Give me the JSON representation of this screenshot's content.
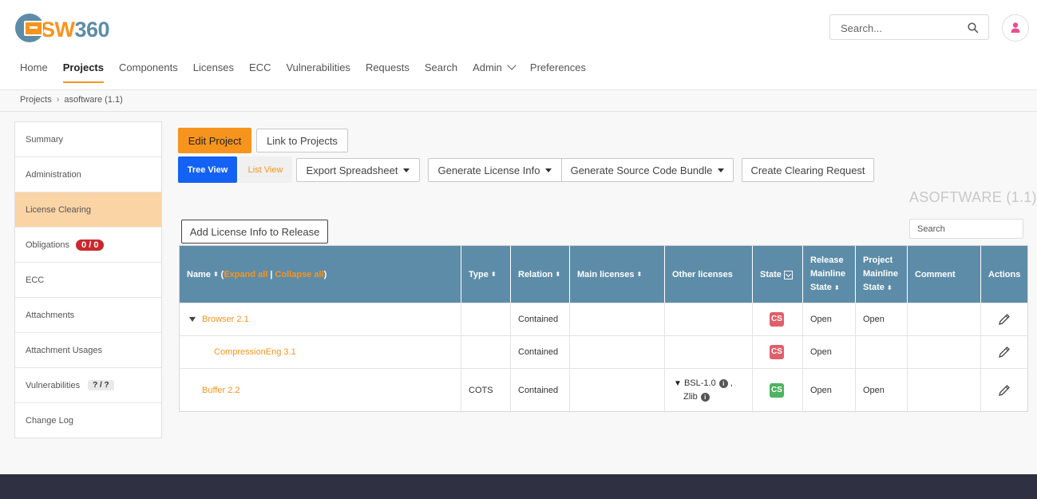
{
  "app": {
    "logo_prefix": "SW",
    "logo_number": "360"
  },
  "search": {
    "placeholder": "Search..."
  },
  "nav": {
    "items": [
      {
        "label": "Home",
        "active": false
      },
      {
        "label": "Projects",
        "active": true
      },
      {
        "label": "Components",
        "active": false
      },
      {
        "label": "Licenses",
        "active": false
      },
      {
        "label": "ECC",
        "active": false
      },
      {
        "label": "Vulnerabilities",
        "active": false
      },
      {
        "label": "Requests",
        "active": false
      },
      {
        "label": "Search",
        "active": false
      },
      {
        "label": "Admin",
        "active": false
      },
      {
        "label": "Preferences",
        "active": false
      }
    ]
  },
  "breadcrumb": {
    "root": "Projects",
    "current": "asoftware (1.1)"
  },
  "sidebar": {
    "items": [
      {
        "label": "Summary"
      },
      {
        "label": "Administration"
      },
      {
        "label": "License Clearing"
      },
      {
        "label": "Obligations",
        "badge": "0 / 0"
      },
      {
        "label": "ECC"
      },
      {
        "label": "Attachments"
      },
      {
        "label": "Attachment Usages"
      },
      {
        "label": "Vulnerabilities",
        "badge": "? / ?"
      },
      {
        "label": "Change Log"
      }
    ]
  },
  "toolbar": {
    "edit_project": "Edit Project",
    "link_projects": "Link to Projects",
    "tree_view": "Tree View",
    "list_view": "List View",
    "export_spreadsheet": "Export Spreadsheet",
    "generate_license_info": "Generate License Info",
    "generate_source_bundle": "Generate Source Code Bundle",
    "create_clearing_request": "Create Clearing Request",
    "add_license_info": "Add License Info to Release"
  },
  "project_title": "ASOFTWARE (1.1)",
  "table": {
    "search_placeholder": "Search",
    "headers": {
      "name": "Name",
      "expand_all": "Expand all",
      "separator": "|",
      "collapse_all": "Collapse all",
      "type": "Type",
      "relation": "Relation",
      "main_licenses": "Main licenses",
      "other_licenses": "Other licenses",
      "state": "State",
      "release_mainline_1": "Release",
      "release_mainline_2": "Mainline",
      "release_mainline_3": "State",
      "project_mainline_1": "Project",
      "project_mainline_2": "Mainline",
      "project_mainline_3": "State",
      "comment": "Comment",
      "actions": "Actions"
    },
    "rows": [
      {
        "name": "Browser 2.1",
        "type": "",
        "relation": "Contained",
        "main_licenses": "",
        "state": "CS",
        "state_color": "#e0606a",
        "release_mainline_state": "Open",
        "project_mainline_state": "Open"
      },
      {
        "name": "CompressionEng 3.1",
        "type": "",
        "relation": "Contained",
        "main_licenses": "",
        "state": "CS",
        "state_color": "#e0606a",
        "release_mainline_state": "Open",
        "project_mainline_state": ""
      },
      {
        "name": "Buffer 2.2",
        "type": "COTS",
        "relation": "Contained",
        "main_licenses": "",
        "other_license_1": "BSL-1.0",
        "other_license_sep": ",",
        "other_license_2": "Zlib",
        "state": "CS",
        "state_color": "#4fb360",
        "release_mainline_state": "Open",
        "project_mainline_state": "Open"
      }
    ]
  },
  "colors": {
    "accent": "#f7941d",
    "header_blue": "#5d8ca8",
    "primary_blue": "#1462f5",
    "footer": "#2f3142"
  }
}
